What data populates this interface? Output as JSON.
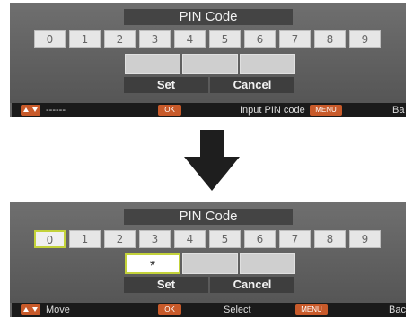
{
  "before": {
    "title": "PIN Code",
    "keys": [
      "0",
      "1",
      "2",
      "3",
      "4",
      "5",
      "6",
      "7",
      "8",
      "9"
    ],
    "slots": [
      "",
      "",
      ""
    ],
    "buttons": {
      "set": "Set",
      "cancel": "Cancel"
    },
    "footer": {
      "nav_chip_icon": "up-down-arrows-icon",
      "nav_text": "------",
      "ok_chip": "OK",
      "text": "Input PIN code",
      "menu_chip": "MENU",
      "back": "Ba"
    }
  },
  "after": {
    "title": "PIN Code",
    "keys": [
      "0",
      "1",
      "2",
      "3",
      "4",
      "5",
      "6",
      "7",
      "8",
      "9"
    ],
    "selected_key": "0",
    "slots": [
      "*",
      "",
      ""
    ],
    "buttons": {
      "set": "Set",
      "cancel": "Cancel"
    },
    "footer": {
      "nav_chip_icon": "up-down-arrows-icon",
      "nav_text": "Move",
      "ok_chip": "OK",
      "text": "Select",
      "menu_chip": "MENU",
      "back": "Bac"
    }
  },
  "transition_icon": "down-arrow-icon",
  "colors": {
    "panel": "#606060",
    "selection_border": "#c3d23a",
    "chip": "#c85a2a",
    "footer": "#1a1a1a"
  }
}
